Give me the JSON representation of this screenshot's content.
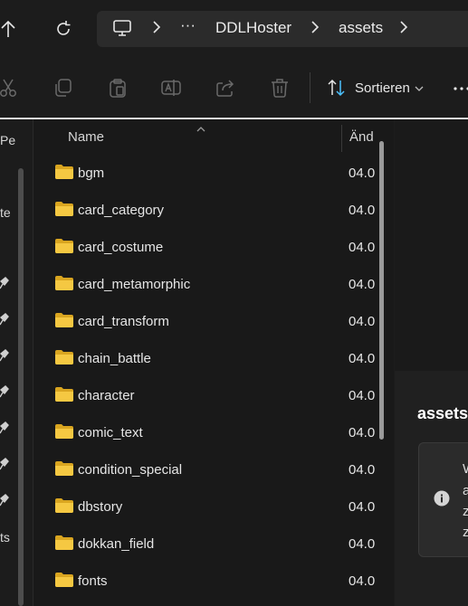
{
  "address_bar": {
    "more_label": "···",
    "crumbs": [
      "DDLHoster",
      "assets"
    ]
  },
  "command_bar": {
    "icons": [
      "cut-icon",
      "copy-icon",
      "paste-icon",
      "rename-icon",
      "share-icon",
      "delete-icon"
    ],
    "sort_label": "Sortieren",
    "more_label": "···"
  },
  "nav_pane": {
    "fragments": [
      "Pe",
      "te",
      "ts"
    ]
  },
  "file_list": {
    "columns": {
      "name": "Name",
      "date": "Änd"
    },
    "rows": [
      {
        "name": "bgm",
        "date": "04.0"
      },
      {
        "name": "card_category",
        "date": "04.0"
      },
      {
        "name": "card_costume",
        "date": "04.0"
      },
      {
        "name": "card_metamorphic",
        "date": "04.0"
      },
      {
        "name": "card_transform",
        "date": "04.0"
      },
      {
        "name": "chain_battle",
        "date": "04.0"
      },
      {
        "name": "character",
        "date": "04.0"
      },
      {
        "name": "comic_text",
        "date": "04.0"
      },
      {
        "name": "condition_special",
        "date": "04.0"
      },
      {
        "name": "dbstory",
        "date": "04.0"
      },
      {
        "name": "dokkan_field",
        "date": "04.0"
      },
      {
        "name": "fonts",
        "date": "04.0"
      }
    ]
  },
  "details_pane": {
    "title": "assets",
    "info_fragments": [
      "W",
      "a",
      "z",
      "z"
    ]
  },
  "colors": {
    "background": "#1c1c1c",
    "folder": "#f5c842",
    "accent": "#4cc2ff"
  }
}
